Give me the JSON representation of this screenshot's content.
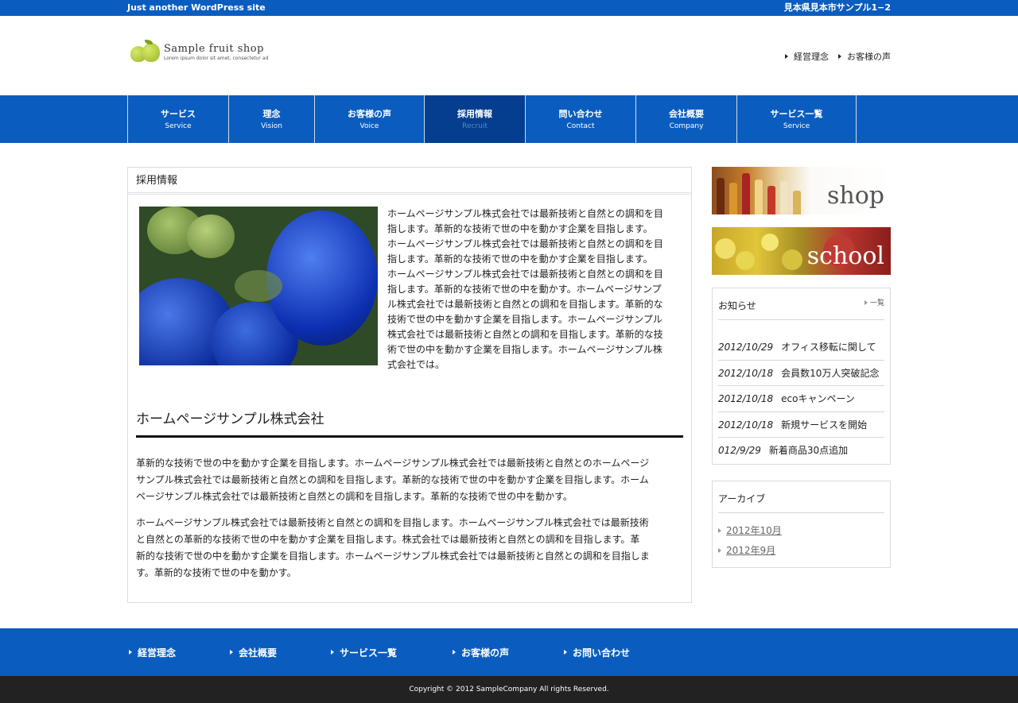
{
  "topbar": {
    "tagline": "Just another WordPress site",
    "address": "見本県見本市サンプル1−2"
  },
  "logo": {
    "name": "Sample fruit shop",
    "tagline": "Lorem ipsum dolor sit amet, consectetur ad"
  },
  "header_links": [
    "経営理念",
    "お客様の声"
  ],
  "nav": [
    {
      "jp": "サービス",
      "en": "Service"
    },
    {
      "jp": "理念",
      "en": "Vision"
    },
    {
      "jp": "お客様の声",
      "en": "Voice"
    },
    {
      "jp": "採用情報",
      "en": "Recruit",
      "active": true
    },
    {
      "jp": "問い合わせ",
      "en": "Contact"
    },
    {
      "jp": "会社概要",
      "en": "Company"
    },
    {
      "jp": "サービス一覧",
      "en": "Service"
    }
  ],
  "content": {
    "page_title": "採用情報",
    "intro_lines": [
      "ホームページサンプル株式会社では最新技術と自然との調和を目",
      "指します。革新的な技術で世の中を動かす企業を目指します。",
      "ホームページサンプル株式会社では最新技術と自然との調和を目",
      "指します。革新的な技術で世の中を動かす企業を目指します。",
      "ホームページサンプル株式会社では最新技術と自然との調和を目",
      "指します。革新的な技術で世の中を動かす。ホームページサンプ",
      "ル株式会社では最新技術と自然との調和を目指します。革新的な",
      "技術で世の中を動かす企業を目指します。ホームページサンプル",
      "株式会社では最新技術と自然との調和を目指します。革新的な技",
      "術で世の中を動かす企業を目指します。ホームページサンプル株",
      "式会社では。"
    ],
    "heading": "ホームページサンプル株式会社",
    "para1_lines": [
      "革新的な技術で世の中を動かす企業を目指します。ホームページサンプル株式会社では最新技術と自然とのホームページ",
      "サンプル株式会社では最新技術と自然との調和を目指します。革新的な技術で世の中を動かす企業を目指します。ホーム",
      "ページサンプル株式会社では最新技術と自然との調和を目指します。革新的な技術で世の中を動かす。"
    ],
    "para2_lines": [
      "ホームページサンプル株式会社では最新技術と自然との調和を目指します。ホームページサンプル株式会社では最新技術",
      "と自然との革新的な技術で世の中を動かす企業を目指します。株式会社では最新技術と自然との調和を目指します。革",
      "新的な技術で世の中を動かす企業を目指します。ホームページサンプル株式会社では最新技術と自然との調和を目指しま",
      "す。革新的な技術で世の中を動かす。"
    ]
  },
  "sidebar": {
    "banner_shop": "shop",
    "banner_school": "school",
    "news_title": "お知らせ",
    "news_more": "一覧",
    "news": [
      {
        "date": "2012/10/29",
        "title": "オフィス移転に関して"
      },
      {
        "date": "2012/10/18",
        "title": "会員数10万人突破記念"
      },
      {
        "date": "2012/10/18",
        "title": "ecoキャンペーン"
      },
      {
        "date": "2012/10/18",
        "title": "新規サービスを開始"
      },
      {
        "date": "012/9/29",
        "title": "新着商品30点追加"
      }
    ],
    "archive_title": "アーカイブ",
    "archive": [
      "2012年10月",
      "2012年9月"
    ]
  },
  "footer_links": [
    "経営理念",
    "会社概要",
    "サービス一覧",
    "お客様の声",
    "お問い合わせ"
  ],
  "copyright": "Copyright © 2012 SampleCompany All rights Reserved."
}
